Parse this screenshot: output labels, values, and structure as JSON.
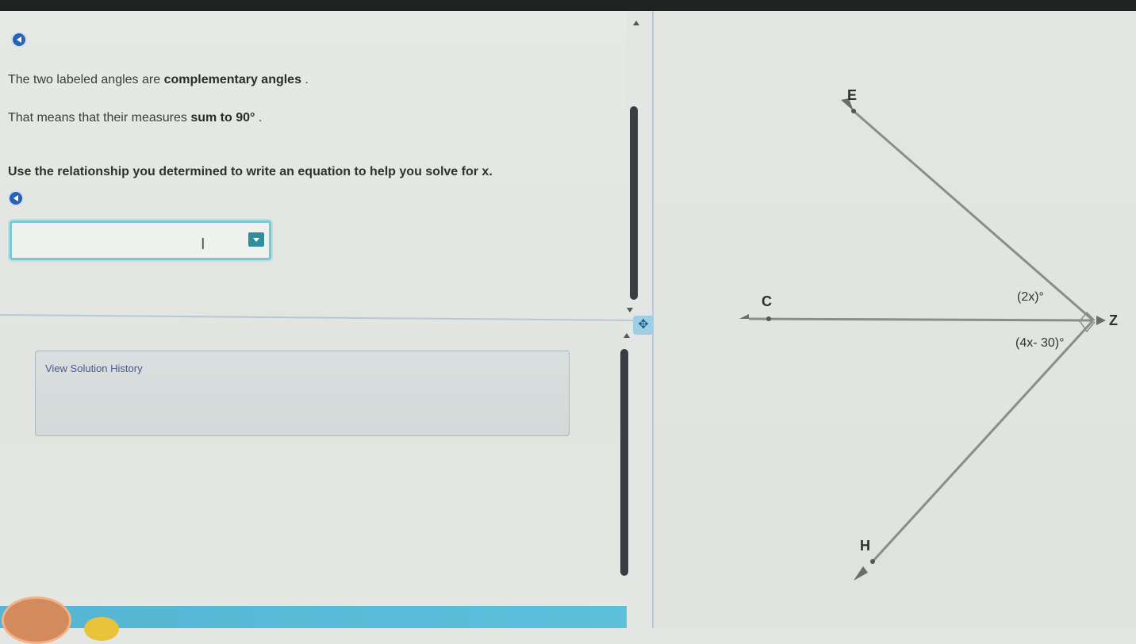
{
  "instructions": {
    "line1_plain": "The two labeled angles are ",
    "line1_bold": "complementary angles",
    "line1_end": " .",
    "line2_plain": "That means that their measures ",
    "line2_bold1": "sum to",
    "line2_bold2": "90°",
    "line2_end": " .",
    "line3": "Use the relationship you determined to write an equation to help you solve for x."
  },
  "answer_input": {
    "value": ""
  },
  "solution_panel": {
    "label": "View Solution History"
  },
  "diagram": {
    "point_e": "E",
    "point_c": "C",
    "point_z": "Z",
    "point_h": "H",
    "angle_upper": "(2x)°",
    "angle_lower": "(4x- 30)°"
  },
  "colors": {
    "accent": "#2a62b8",
    "input_border": "#7fc6d3",
    "dropdown": "#2f8e9e",
    "line": "#8a8d8b"
  }
}
